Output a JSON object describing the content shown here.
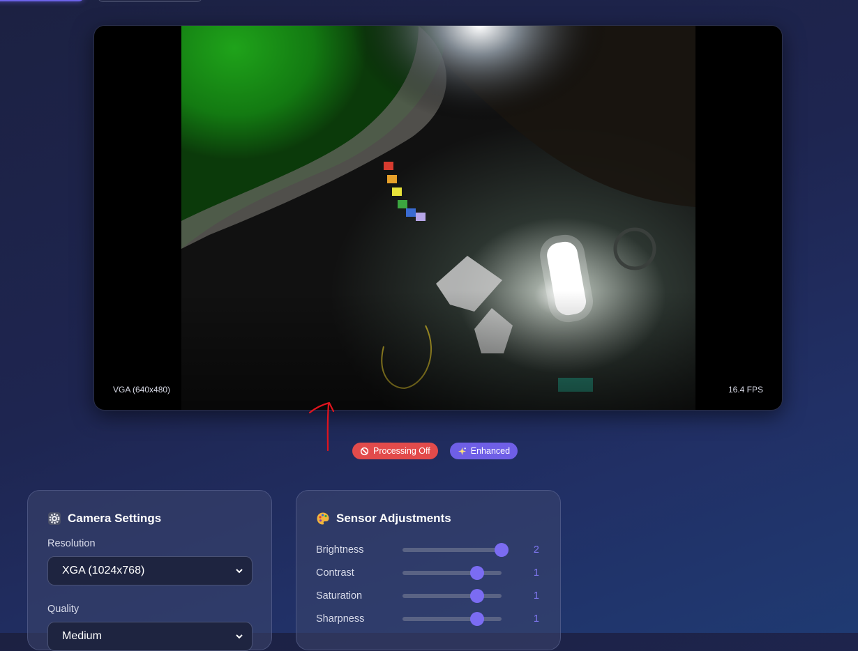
{
  "video": {
    "resolution_label": "VGA (640x480)",
    "fps_label": "16.4 FPS"
  },
  "badges": [
    {
      "label": "Processing Off",
      "icon": "no-entry-icon",
      "color": "#e24b4b"
    },
    {
      "label": "Enhanced",
      "icon": "sparkles-icon",
      "color": "#6f5fe6"
    }
  ],
  "camera_settings": {
    "title": "Camera Settings",
    "icon": "gear-icon",
    "resolution_label": "Resolution",
    "resolution_value": "XGA (1024x768)",
    "quality_label": "Quality",
    "quality_value": "Medium"
  },
  "sensor_adjustments": {
    "title": "Sensor Adjustments",
    "icon": "palette-icon",
    "sliders": [
      {
        "label": "Brightness",
        "value": "2",
        "min": -2,
        "max": 2,
        "level": 2
      },
      {
        "label": "Contrast",
        "value": "1",
        "min": -2,
        "max": 2,
        "level": 1
      },
      {
        "label": "Saturation",
        "value": "1",
        "min": -2,
        "max": 2,
        "level": 1
      },
      {
        "label": "Sharpness",
        "value": "1",
        "min": -2,
        "max": 2,
        "level": 1
      }
    ]
  },
  "colors": {
    "accent": "#7b6cf2",
    "danger": "#e24b4b",
    "annotation": "#e0141e"
  }
}
